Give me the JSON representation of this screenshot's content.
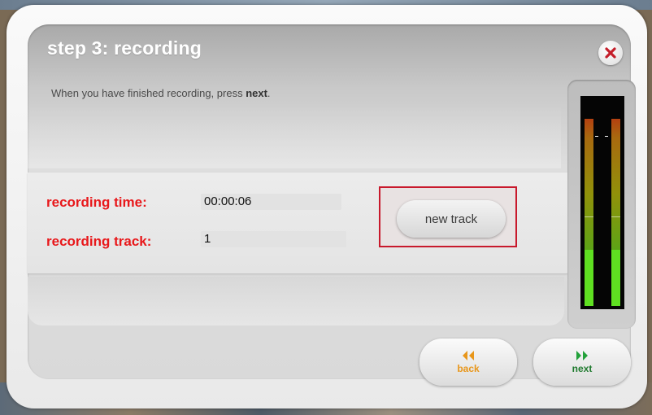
{
  "dialog": {
    "title": "step 3: recording",
    "instruction_prefix": "When you have finished recording, press ",
    "instruction_bold": "next",
    "instruction_suffix": "."
  },
  "recording": {
    "time_label": "recording time:",
    "time_value": "00:00:06",
    "track_label": "recording track:",
    "track_value": "1"
  },
  "buttons": {
    "new_track": "new track",
    "back": "back",
    "next": "next",
    "close_icon": "close-icon",
    "back_icon": "double-chevron-left-icon",
    "next_icon": "double-chevron-right-icon"
  },
  "meter": {
    "left_level": 0.3,
    "right_level": 0.3
  },
  "colors": {
    "label_red": "#e8181b",
    "back_orange": "#e8961a",
    "next_green": "#22a13a",
    "highlight_border": "#c8192c"
  }
}
